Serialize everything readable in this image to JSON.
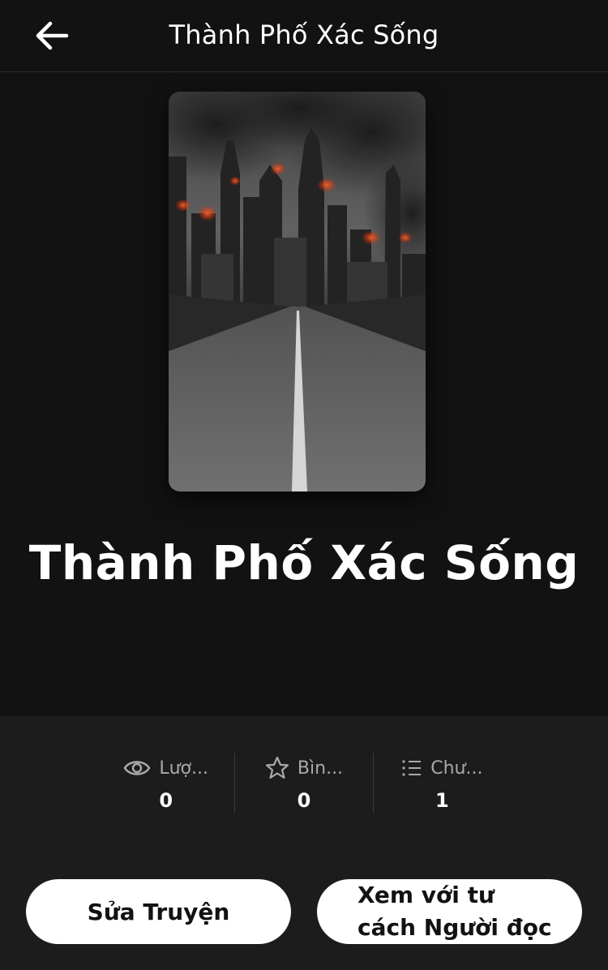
{
  "header": {
    "title": "Thành Phố Xác Sống",
    "back_icon": "arrow-left-icon"
  },
  "story": {
    "title": "Thành Phố Xác Sống",
    "cover_description_icon": "book-cover-image"
  },
  "stats": [
    {
      "icon": "eye-icon",
      "label": "Lượ...",
      "value": "0"
    },
    {
      "icon": "star-icon",
      "label": "Bìn...",
      "value": "0"
    },
    {
      "icon": "list-icon",
      "label": "Chư...",
      "value": "1"
    }
  ],
  "actions": {
    "edit_label": "Sửa Truyện",
    "reader_label": "Xem với tư cách Người đọc"
  },
  "colors": {
    "background": "#121212",
    "panel": "#1c1c1c",
    "button": "#ffffff",
    "button_text": "#121212"
  }
}
